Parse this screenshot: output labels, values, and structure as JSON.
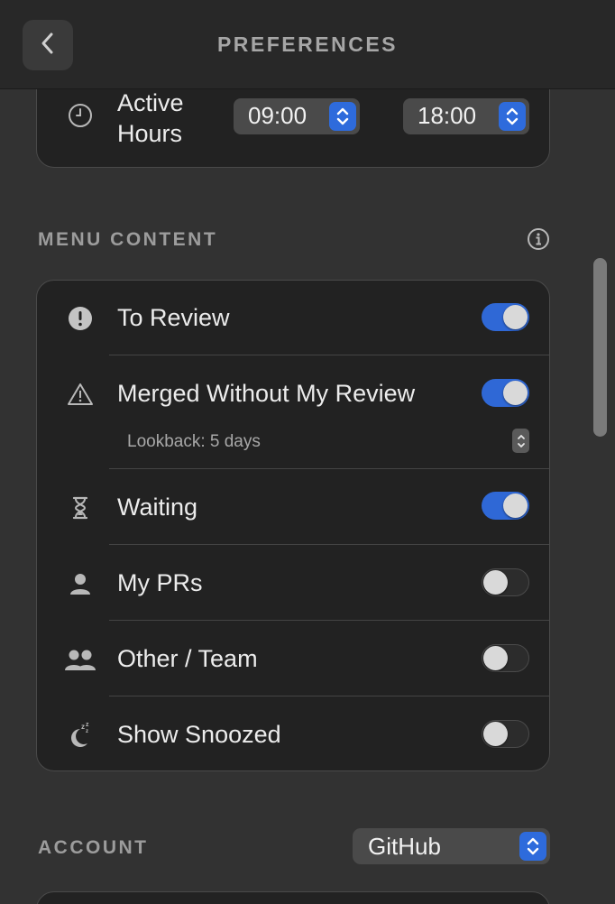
{
  "header": {
    "title": "PREFERENCES"
  },
  "active_hours": {
    "label_line1": "Active",
    "label_line2": "Hours",
    "start": "09:00",
    "end": "18:00"
  },
  "menu_content": {
    "section_label": "MENU CONTENT",
    "items": [
      {
        "label": "To Review",
        "icon": "exclamation-circle-icon",
        "enabled": true
      },
      {
        "label": "Merged Without My Review",
        "icon": "warning-triangle-icon",
        "enabled": true,
        "sub_label": "Lookback: 5 days"
      },
      {
        "label": "Waiting",
        "icon": "hourglass-icon",
        "enabled": true
      },
      {
        "label": "My PRs",
        "icon": "person-icon",
        "enabled": false
      },
      {
        "label": "Other / Team",
        "icon": "people-icon",
        "enabled": false
      },
      {
        "label": "Show Snoozed",
        "icon": "moon-zzz-icon",
        "enabled": false
      }
    ]
  },
  "account": {
    "section_label": "ACCOUNT",
    "provider": "GitHub"
  },
  "colors": {
    "accent": "#2f68d6",
    "background": "#323232",
    "card": "#222222"
  }
}
